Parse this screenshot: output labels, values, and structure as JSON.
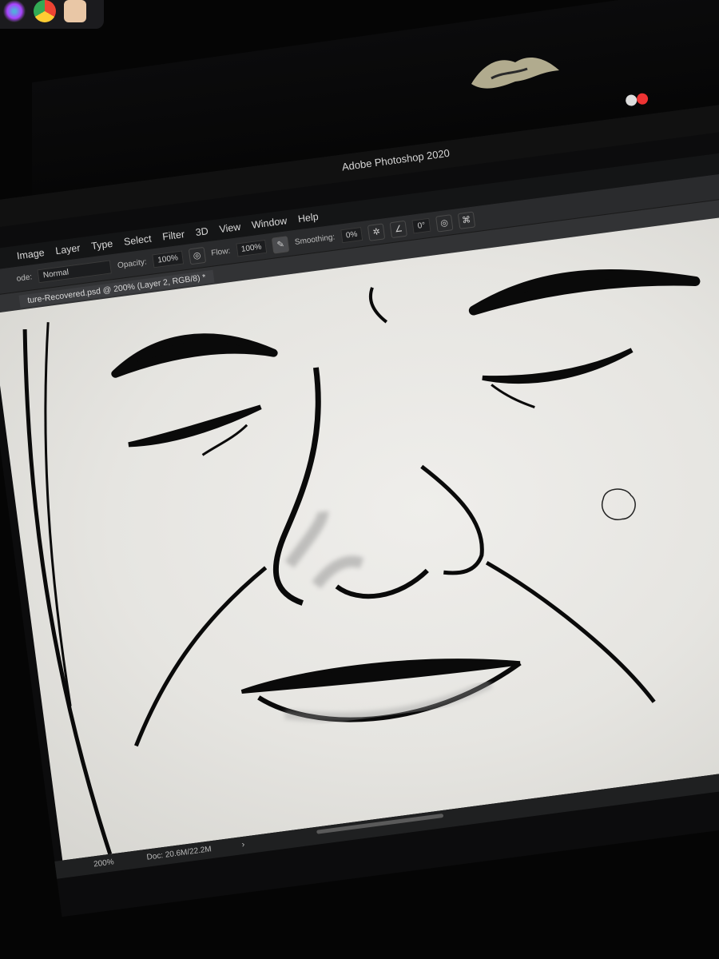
{
  "window": {
    "app_title": "Adobe Photoshop 2020"
  },
  "menu": [
    "Image",
    "Layer",
    "Type",
    "Select",
    "Filter",
    "3D",
    "View",
    "Window",
    "Help"
  ],
  "options_bar": {
    "mode_label": "ode:",
    "mode_value": "Normal",
    "opacity_label": "Opacity:",
    "opacity_value": "100%",
    "flow_label": "Flow:",
    "flow_value": "100%",
    "smoothing_label": "Smoothing:",
    "smoothing_value": "0%",
    "angle_value": "0°"
  },
  "document": {
    "tab_title": "ture-Recovered.psd @ 200% (Layer 2, RGB/8) *"
  },
  "status": {
    "zoom": "200%",
    "doc_size": "Doc: 20.6M/22.2M",
    "arrow": "›"
  },
  "icons": [
    "siri-icon",
    "chrome-icon",
    "mail-icon",
    "airbrush-icon",
    "pressure-icon",
    "settings-icon",
    "angle-icon",
    "symmetry-icon",
    "butterfly-icon"
  ],
  "colors": {
    "canvas": "#e9e8e4",
    "ink": "#0a0a0a",
    "menubar": "#141516",
    "options_bar": "#2a2b2d"
  }
}
